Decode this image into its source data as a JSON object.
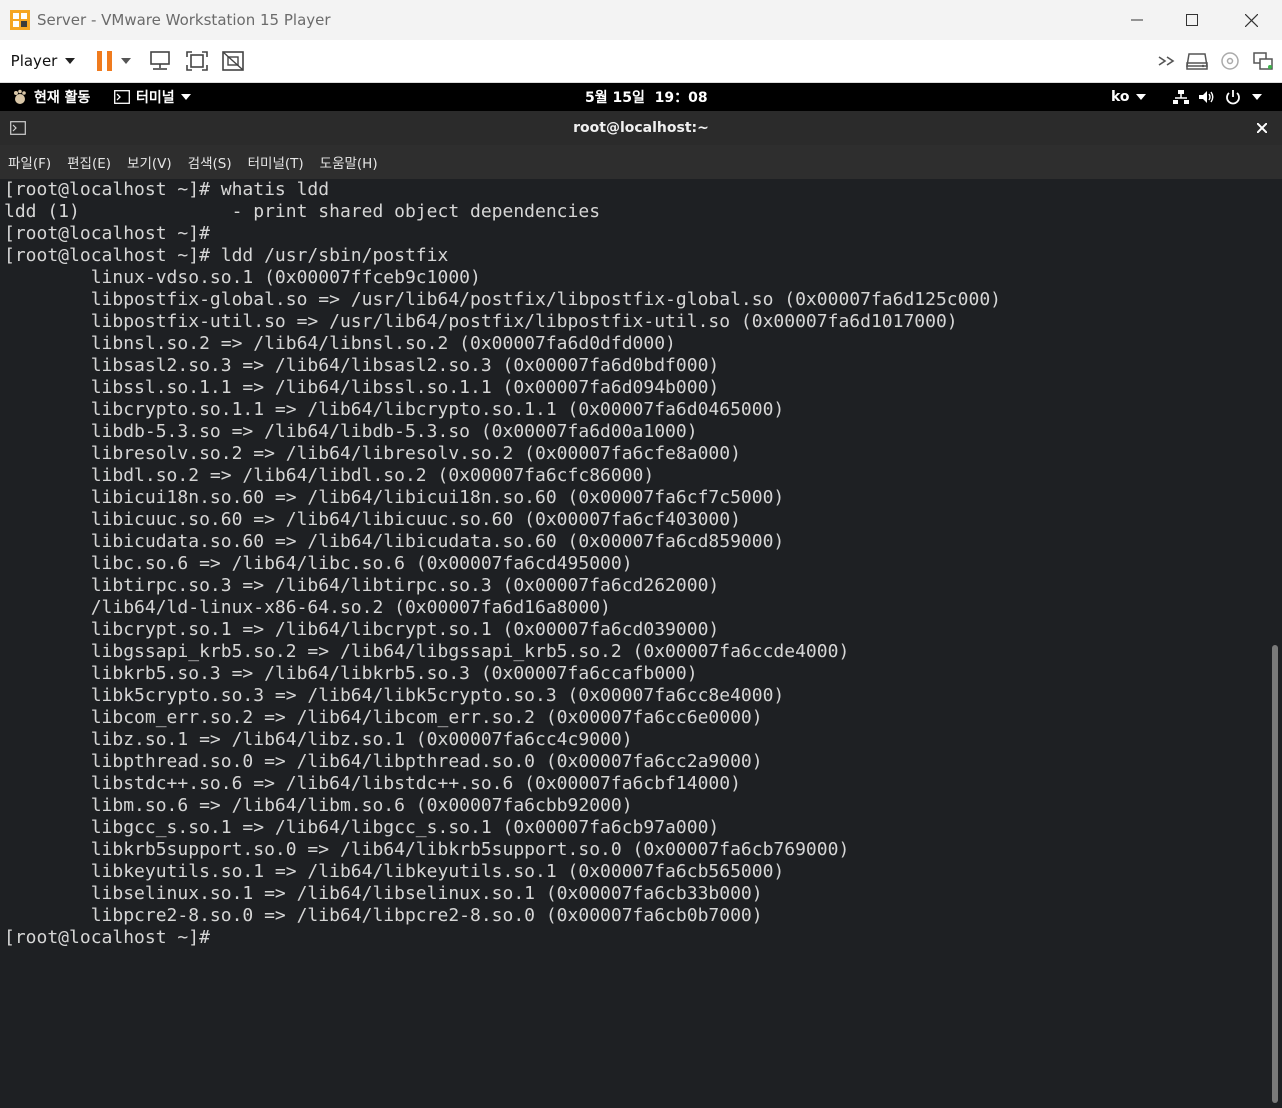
{
  "window": {
    "title": "Server - VMware Workstation 15 Player"
  },
  "toolbar": {
    "player_label": "Player"
  },
  "topbar": {
    "activities": "현재 활동",
    "app_menu": "터미널",
    "clock": "5월 15일  19：08",
    "input_method": "ko"
  },
  "terminal": {
    "title": "root@localhost:~",
    "menu": [
      "파일(F)",
      "편집(E)",
      "보기(V)",
      "검색(S)",
      "터미널(T)",
      "도움말(H)"
    ],
    "lines": [
      "[root@localhost ~]# whatis ldd",
      "ldd (1)              - print shared object dependencies",
      "[root@localhost ~]#",
      "[root@localhost ~]# ldd /usr/sbin/postfix",
      "        linux-vdso.so.1 (0x00007ffceb9c1000)",
      "        libpostfix-global.so => /usr/lib64/postfix/libpostfix-global.so (0x00007fa6d125c000)",
      "        libpostfix-util.so => /usr/lib64/postfix/libpostfix-util.so (0x00007fa6d1017000)",
      "        libnsl.so.2 => /lib64/libnsl.so.2 (0x00007fa6d0dfd000)",
      "        libsasl2.so.3 => /lib64/libsasl2.so.3 (0x00007fa6d0bdf000)",
      "        libssl.so.1.1 => /lib64/libssl.so.1.1 (0x00007fa6d094b000)",
      "        libcrypto.so.1.1 => /lib64/libcrypto.so.1.1 (0x00007fa6d0465000)",
      "        libdb-5.3.so => /lib64/libdb-5.3.so (0x00007fa6d00a1000)",
      "        libresolv.so.2 => /lib64/libresolv.so.2 (0x00007fa6cfe8a000)",
      "        libdl.so.2 => /lib64/libdl.so.2 (0x00007fa6cfc86000)",
      "        libicui18n.so.60 => /lib64/libicui18n.so.60 (0x00007fa6cf7c5000)",
      "        libicuuc.so.60 => /lib64/libicuuc.so.60 (0x00007fa6cf403000)",
      "        libicudata.so.60 => /lib64/libicudata.so.60 (0x00007fa6cd859000)",
      "        libc.so.6 => /lib64/libc.so.6 (0x00007fa6cd495000)",
      "        libtirpc.so.3 => /lib64/libtirpc.so.3 (0x00007fa6cd262000)",
      "        /lib64/ld-linux-x86-64.so.2 (0x00007fa6d16a8000)",
      "        libcrypt.so.1 => /lib64/libcrypt.so.1 (0x00007fa6cd039000)",
      "        libgssapi_krb5.so.2 => /lib64/libgssapi_krb5.so.2 (0x00007fa6ccde4000)",
      "        libkrb5.so.3 => /lib64/libkrb5.so.3 (0x00007fa6ccafb000)",
      "        libk5crypto.so.3 => /lib64/libk5crypto.so.3 (0x00007fa6cc8e4000)",
      "        libcom_err.so.2 => /lib64/libcom_err.so.2 (0x00007fa6cc6e0000)",
      "        libz.so.1 => /lib64/libz.so.1 (0x00007fa6cc4c9000)",
      "        libpthread.so.0 => /lib64/libpthread.so.0 (0x00007fa6cc2a9000)",
      "        libstdc++.so.6 => /lib64/libstdc++.so.6 (0x00007fa6cbf14000)",
      "        libm.so.6 => /lib64/libm.so.6 (0x00007fa6cbb92000)",
      "        libgcc_s.so.1 => /lib64/libgcc_s.so.1 (0x00007fa6cb97a000)",
      "        libkrb5support.so.0 => /lib64/libkrb5support.so.0 (0x00007fa6cb769000)",
      "        libkeyutils.so.1 => /lib64/libkeyutils.so.1 (0x00007fa6cb565000)",
      "        libselinux.so.1 => /lib64/libselinux.so.1 (0x00007fa6cb33b000)",
      "        libpcre2-8.so.0 => /lib64/libpcre2-8.so.0 (0x00007fa6cb0b7000)",
      "[root@localhost ~]#"
    ]
  },
  "colors": {
    "terminal_bg": "#1e2023",
    "terminal_fg": "#d6d6d6",
    "pause_orange": "#f07b1e"
  },
  "icons": {
    "app_logo": "vmware-logo-icon",
    "pause": "pause-icon",
    "send_cad": "send-ctrl-alt-del-icon",
    "fullscreen": "fullscreen-icon",
    "unity": "unity-icon",
    "more": "double-chevron-icon",
    "hdd": "hard-disk-icon",
    "cd": "cd-rom-icon",
    "network": "network-adapter-icon"
  }
}
